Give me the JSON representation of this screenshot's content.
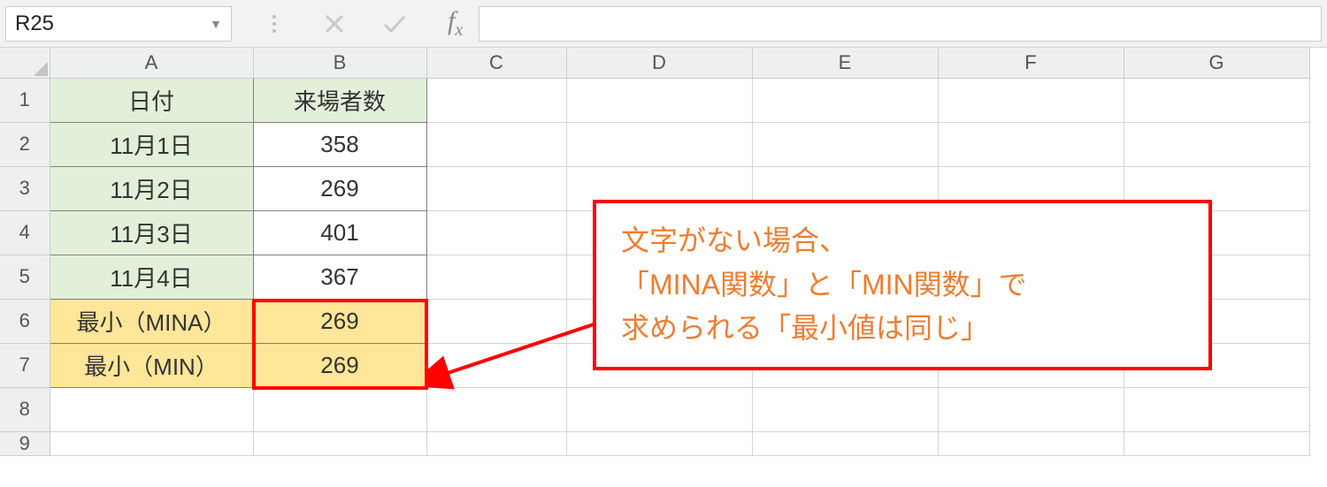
{
  "namebox": {
    "value": "R25"
  },
  "formula": "",
  "columns": [
    "A",
    "B",
    "C",
    "D",
    "E",
    "F",
    "G"
  ],
  "rows": [
    "1",
    "2",
    "3",
    "4",
    "5",
    "6",
    "7",
    "8",
    "9"
  ],
  "cells": {
    "A1": "日付",
    "B1": "来場者数",
    "A2": "11月1日",
    "B2": "358",
    "A3": "11月2日",
    "B3": "269",
    "A4": "11月3日",
    "B4": "401",
    "A5": "11月4日",
    "B5": "367",
    "A6": "最小（MINA）",
    "B6": "269",
    "A7": "最小（MIN）",
    "B7": "269"
  },
  "annotation": {
    "line1": "文字がない場合、",
    "line2": "「MINA関数」と「MIN関数」で",
    "line3": "求められる「最小値は同じ」"
  }
}
